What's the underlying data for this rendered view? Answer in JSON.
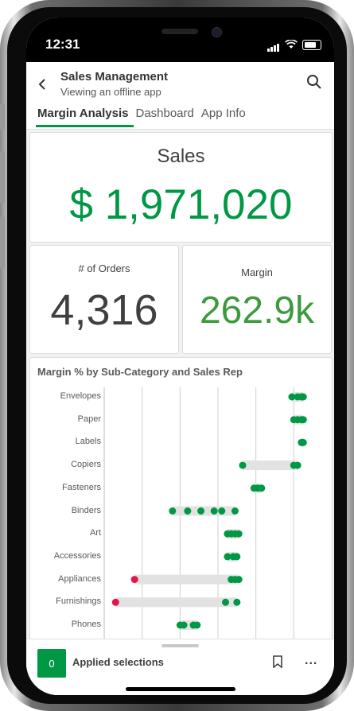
{
  "status_bar": {
    "time": "12:31"
  },
  "header": {
    "title": "Sales Management",
    "subtitle": "Viewing an offline app",
    "back_icon": "chevron-left-icon",
    "search_icon": "search-icon"
  },
  "tabs": [
    {
      "label": "Margin Analysis",
      "active": true
    },
    {
      "label": "Dashboard",
      "active": false
    },
    {
      "label": "App Info",
      "active": false
    }
  ],
  "kpis": {
    "sales": {
      "label": "Sales",
      "value": "$ 1,971,020"
    },
    "orders": {
      "label": "# of Orders",
      "value": "4,316"
    },
    "margin": {
      "label": "Margin",
      "value": "262.9k"
    }
  },
  "colors": {
    "accent": "#009845",
    "negative": "#e2164b",
    "dark_value": "#404040",
    "range_bar": "#e2e2e2"
  },
  "chart_data": {
    "type": "scatter",
    "title": "Margin % by Sub-Category and Sales Rep",
    "categories": [
      "Envelopes",
      "Paper",
      "Labels",
      "Copiers",
      "Fasteners",
      "Binders",
      "Art",
      "Accessories",
      "Appliances",
      "Furnishings",
      "Phones"
    ],
    "xlim": [
      -0.6,
      0.6
    ],
    "gridlines": [
      -0.4,
      -0.2,
      0,
      0.2,
      0.4
    ],
    "points": [
      [
        0.39,
        0.42,
        0.44,
        0.45
      ],
      [
        0.4,
        0.42,
        0.44,
        0.45
      ],
      [
        0.44,
        0.45
      ],
      [
        0.13,
        0.4,
        0.42
      ],
      [
        0.19,
        0.21,
        0.23
      ],
      [
        -0.24,
        -0.16,
        -0.09,
        -0.02,
        0.02,
        0.09
      ],
      [
        0.05,
        0.07,
        0.09,
        0.11
      ],
      [
        0.05,
        0.08,
        0.1
      ],
      [
        -0.44,
        0.07,
        0.09,
        0.11
      ],
      [
        -0.54,
        0.04,
        0.1
      ],
      [
        -0.2,
        -0.18,
        -0.13,
        -0.11
      ]
    ]
  },
  "bottom_bar": {
    "count": "0",
    "label": "Applied selections",
    "bookmark_icon": "bookmark-icon",
    "more": "..."
  }
}
